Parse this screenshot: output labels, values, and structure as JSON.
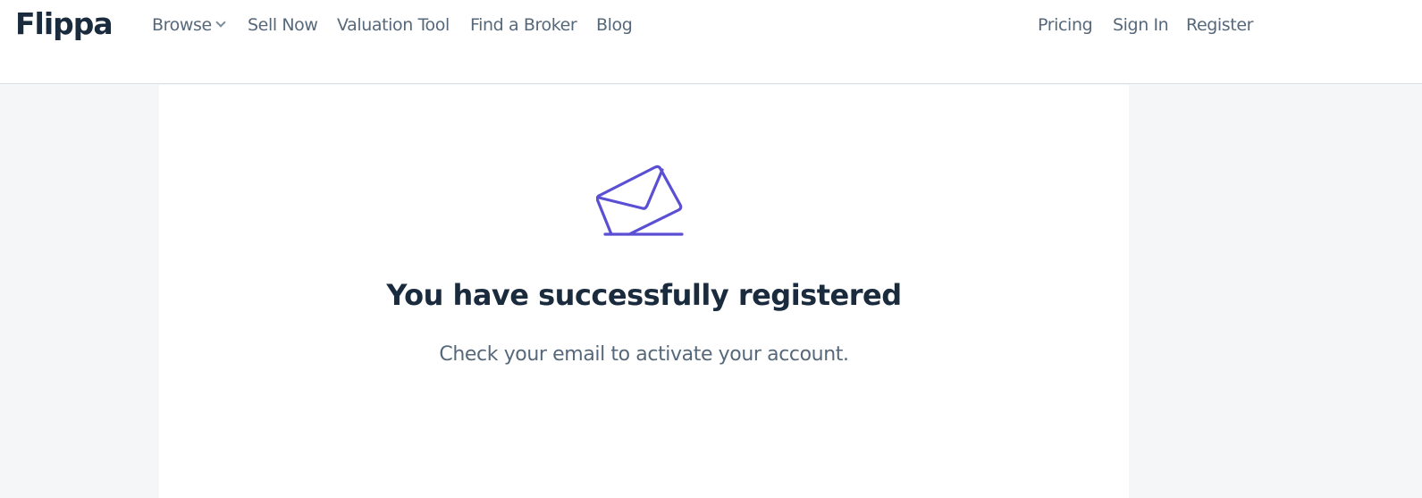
{
  "header": {
    "logo": "Flippa",
    "nav_left": [
      {
        "label": "Browse",
        "has_dropdown": true
      },
      {
        "label": "Sell Now"
      },
      {
        "label": "Valuation Tool"
      },
      {
        "label": "Find a Broker"
      },
      {
        "label": "Blog"
      }
    ],
    "nav_right": [
      {
        "label": "Pricing"
      },
      {
        "label": "Sign In"
      },
      {
        "label": "Register"
      }
    ]
  },
  "main": {
    "icon": "envelope-icon",
    "title": "You have successfully registered",
    "message": "Check your email to activate your account."
  },
  "colors": {
    "accent": "#5b4fd4",
    "heading": "#1b2b3e",
    "muted_text": "#56687a",
    "page_background": "#f5f6f8"
  }
}
